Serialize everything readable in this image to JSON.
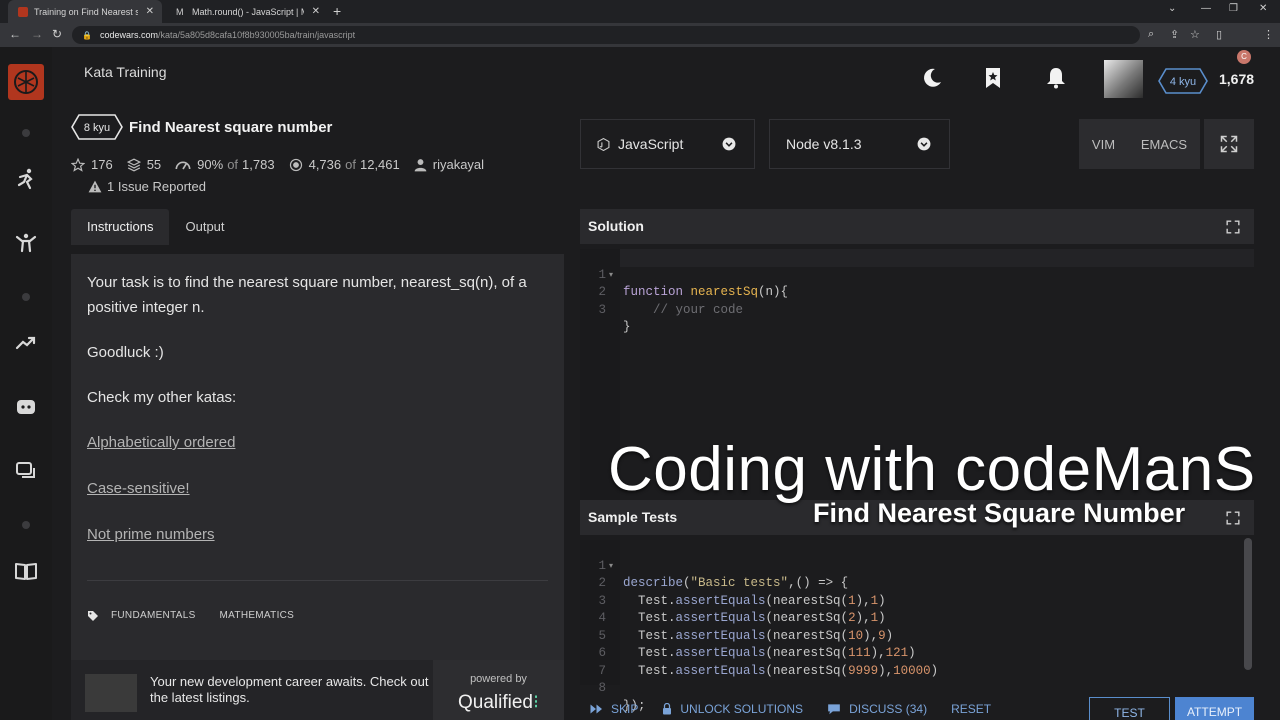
{
  "browser": {
    "tabs": [
      {
        "title": "Training on Find Nearest square",
        "active": true
      },
      {
        "title": "Math.round() - JavaScript | MDN",
        "active": false
      }
    ],
    "new_tab": "+",
    "url_host": "codewars.com",
    "url_path": "/kata/5a805d8cafa10f8b930005ba/train/javascript",
    "profile_initial": "C"
  },
  "header": {
    "section_title": "Kata Training",
    "rank": "4 kyu",
    "honor": "1,678"
  },
  "kata": {
    "rank": "8 kyu",
    "title": "Find Nearest square number",
    "stars": "176",
    "collections": "55",
    "satisfaction": "90%",
    "satisfaction_of": "of",
    "satisfaction_total": "1,783",
    "completed": "4,736",
    "completed_of": "of",
    "completed_total": "12,461",
    "author": "riyakayal",
    "issues": "1 Issue Reported"
  },
  "panel_tabs": [
    "Instructions",
    "Output"
  ],
  "instructions": {
    "paragraph1": "Your task is to find the nearest square number, nearest_sq(n), of a positive integer n.",
    "paragraph2": "Goodluck :)",
    "paragraph3": "Check my other katas:",
    "links": [
      "Alphabetically ordered",
      "Case-sensitive!",
      "Not prime numbers"
    ],
    "tags": [
      "FUNDAMENTALS",
      "MATHEMATICS"
    ]
  },
  "ad": {
    "text": "Your new development career awaits. Check out the latest listings.",
    "powered_by": "powered by",
    "brand": "Qualified"
  },
  "language_select": "JavaScript",
  "version_select": "Node v8.1.3",
  "modes": [
    "VIM",
    "EMACS"
  ],
  "solution": {
    "heading": "Solution",
    "lines": [
      "1",
      "2",
      "3"
    ]
  },
  "sample_tests": {
    "heading": "Sample Tests",
    "lines": [
      "1",
      "2",
      "3",
      "4",
      "5",
      "6",
      "7",
      "8"
    ]
  },
  "overlay": {
    "title": "Coding with codeManS",
    "subtitle": "Find Nearest Square Number"
  },
  "actions": {
    "skip": "SKIP",
    "unlock": "UNLOCK SOLUTIONS",
    "discuss": "DISCUSS (34)",
    "reset": "RESET",
    "test": "TEST",
    "attempt": "ATTEMPT"
  },
  "colors": {
    "background": "#1c1c1e",
    "panel": "#2a2a2d",
    "brand_red": "#b1361e",
    "action_blue": "#4d84d1",
    "rank_blue": "#5a8ecc"
  }
}
